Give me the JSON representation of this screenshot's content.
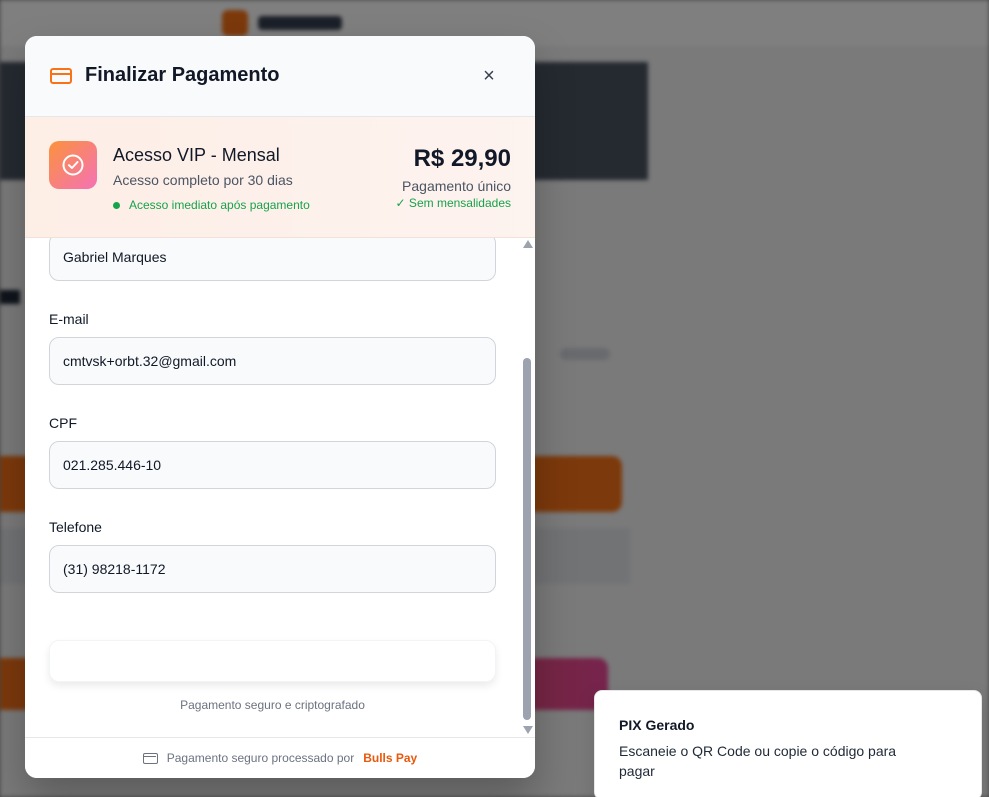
{
  "modal": {
    "title": "Finalizar Pagamento",
    "close_label": "×"
  },
  "product": {
    "name": "Acesso VIP - Mensal",
    "description": "Acesso completo por 30 dias",
    "access_note": "Acesso imediato após pagamento",
    "price": "R$ 29,90",
    "price_note": "Pagamento único",
    "no_subscription": "✓ Sem mensalidades"
  },
  "form": {
    "name_value": "Gabriel Marques",
    "email_label": "E-mail",
    "email_value": "cmtvsk+orbt.32@gmail.com",
    "cpf_label": "CPF",
    "cpf_value": "021.285.446-10",
    "phone_label": "Telefone",
    "phone_value": "(31) 98218-1172",
    "secure_note": "Pagamento seguro e criptografado"
  },
  "footer": {
    "text": "Pagamento seguro processado por",
    "brand": "Bulls Pay"
  },
  "toast": {
    "title": "PIX Gerado",
    "message": "Escaneie o QR Code ou copie o código para pagar"
  },
  "colors": {
    "accent": "#f97316",
    "success": "#16a34a",
    "brand": "#ea580c"
  }
}
